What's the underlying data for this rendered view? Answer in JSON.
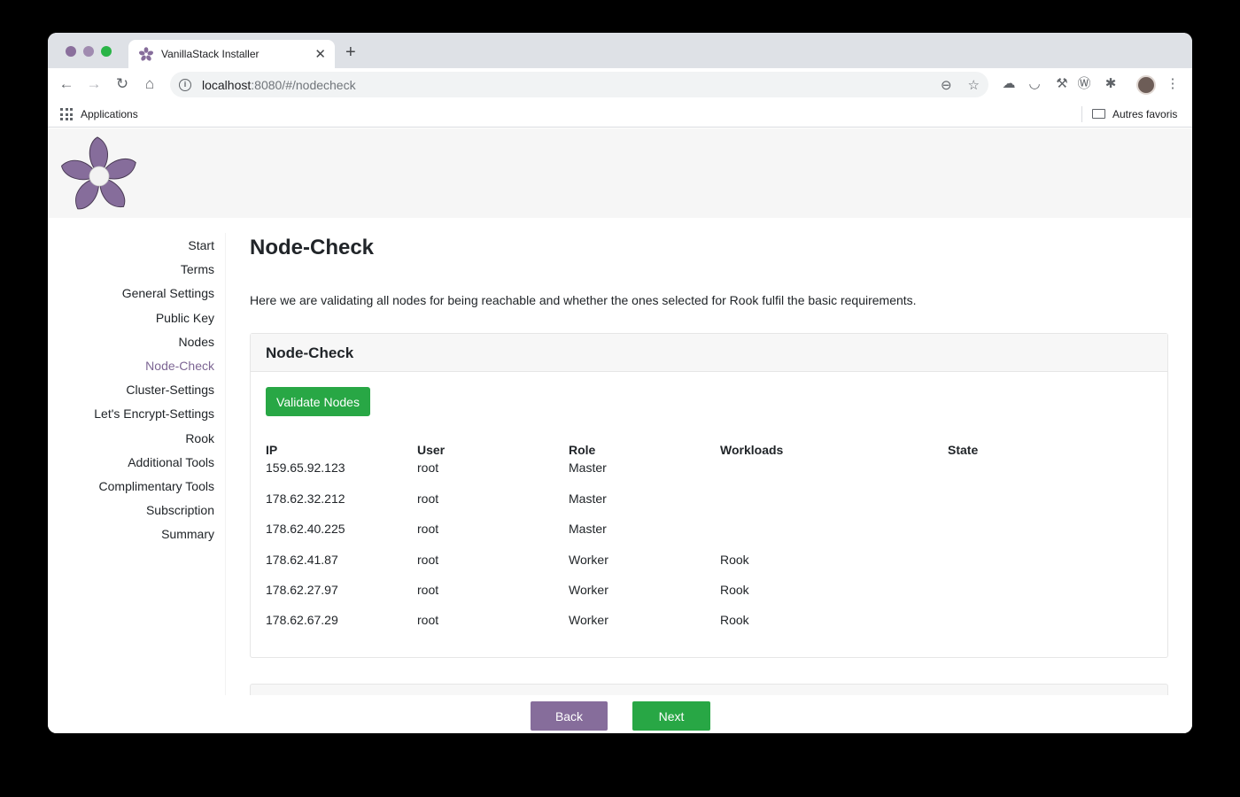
{
  "browser": {
    "tab_title": "VanillaStack Installer",
    "tab_close": "✕",
    "new_tab": "+",
    "url_host": "localhost",
    "url_rest": ":8080/#/nodecheck",
    "bookmark_apps": "Applications",
    "bookmark_other": "Autres favoris",
    "traffic_colors": [
      "#8a6f9c",
      "#a08bb0",
      "#2ab447"
    ]
  },
  "sidebar": {
    "items": [
      {
        "label": "Start"
      },
      {
        "label": "Terms"
      },
      {
        "label": "General Settings"
      },
      {
        "label": "Public Key"
      },
      {
        "label": "Nodes"
      },
      {
        "label": "Node-Check",
        "active": true
      },
      {
        "label": "Cluster-Settings"
      },
      {
        "label": "Let's Encrypt-Settings"
      },
      {
        "label": "Rook"
      },
      {
        "label": "Additional Tools"
      },
      {
        "label": "Complimentary Tools"
      },
      {
        "label": "Subscription"
      },
      {
        "label": "Summary"
      }
    ]
  },
  "main": {
    "title": "Node-Check",
    "description": "Here we are validating all nodes for being reachable and whether the ones selected for Rook fulfil the basic requirements.",
    "card_title": "Node-Check",
    "validate_button": "Validate Nodes",
    "table": {
      "headers": [
        "IP",
        "User",
        "Role",
        "Workloads",
        "State"
      ],
      "rows": [
        [
          "159.65.92.123",
          "root",
          "Master",
          "",
          ""
        ],
        [
          "178.62.32.212",
          "root",
          "Master",
          "",
          ""
        ],
        [
          "178.62.40.225",
          "root",
          "Master",
          "",
          ""
        ],
        [
          "178.62.41.87",
          "root",
          "Worker",
          "Rook",
          ""
        ],
        [
          "178.62.27.97",
          "root",
          "Worker",
          "Rook",
          ""
        ],
        [
          "178.62.67.29",
          "root",
          "Worker",
          "Rook",
          ""
        ]
      ]
    }
  },
  "footer": {
    "back": "Back",
    "next": "Next"
  },
  "colors": {
    "brand_purple": "#866d9b",
    "success_green": "#28a745",
    "active_nav": "#7d6694"
  }
}
